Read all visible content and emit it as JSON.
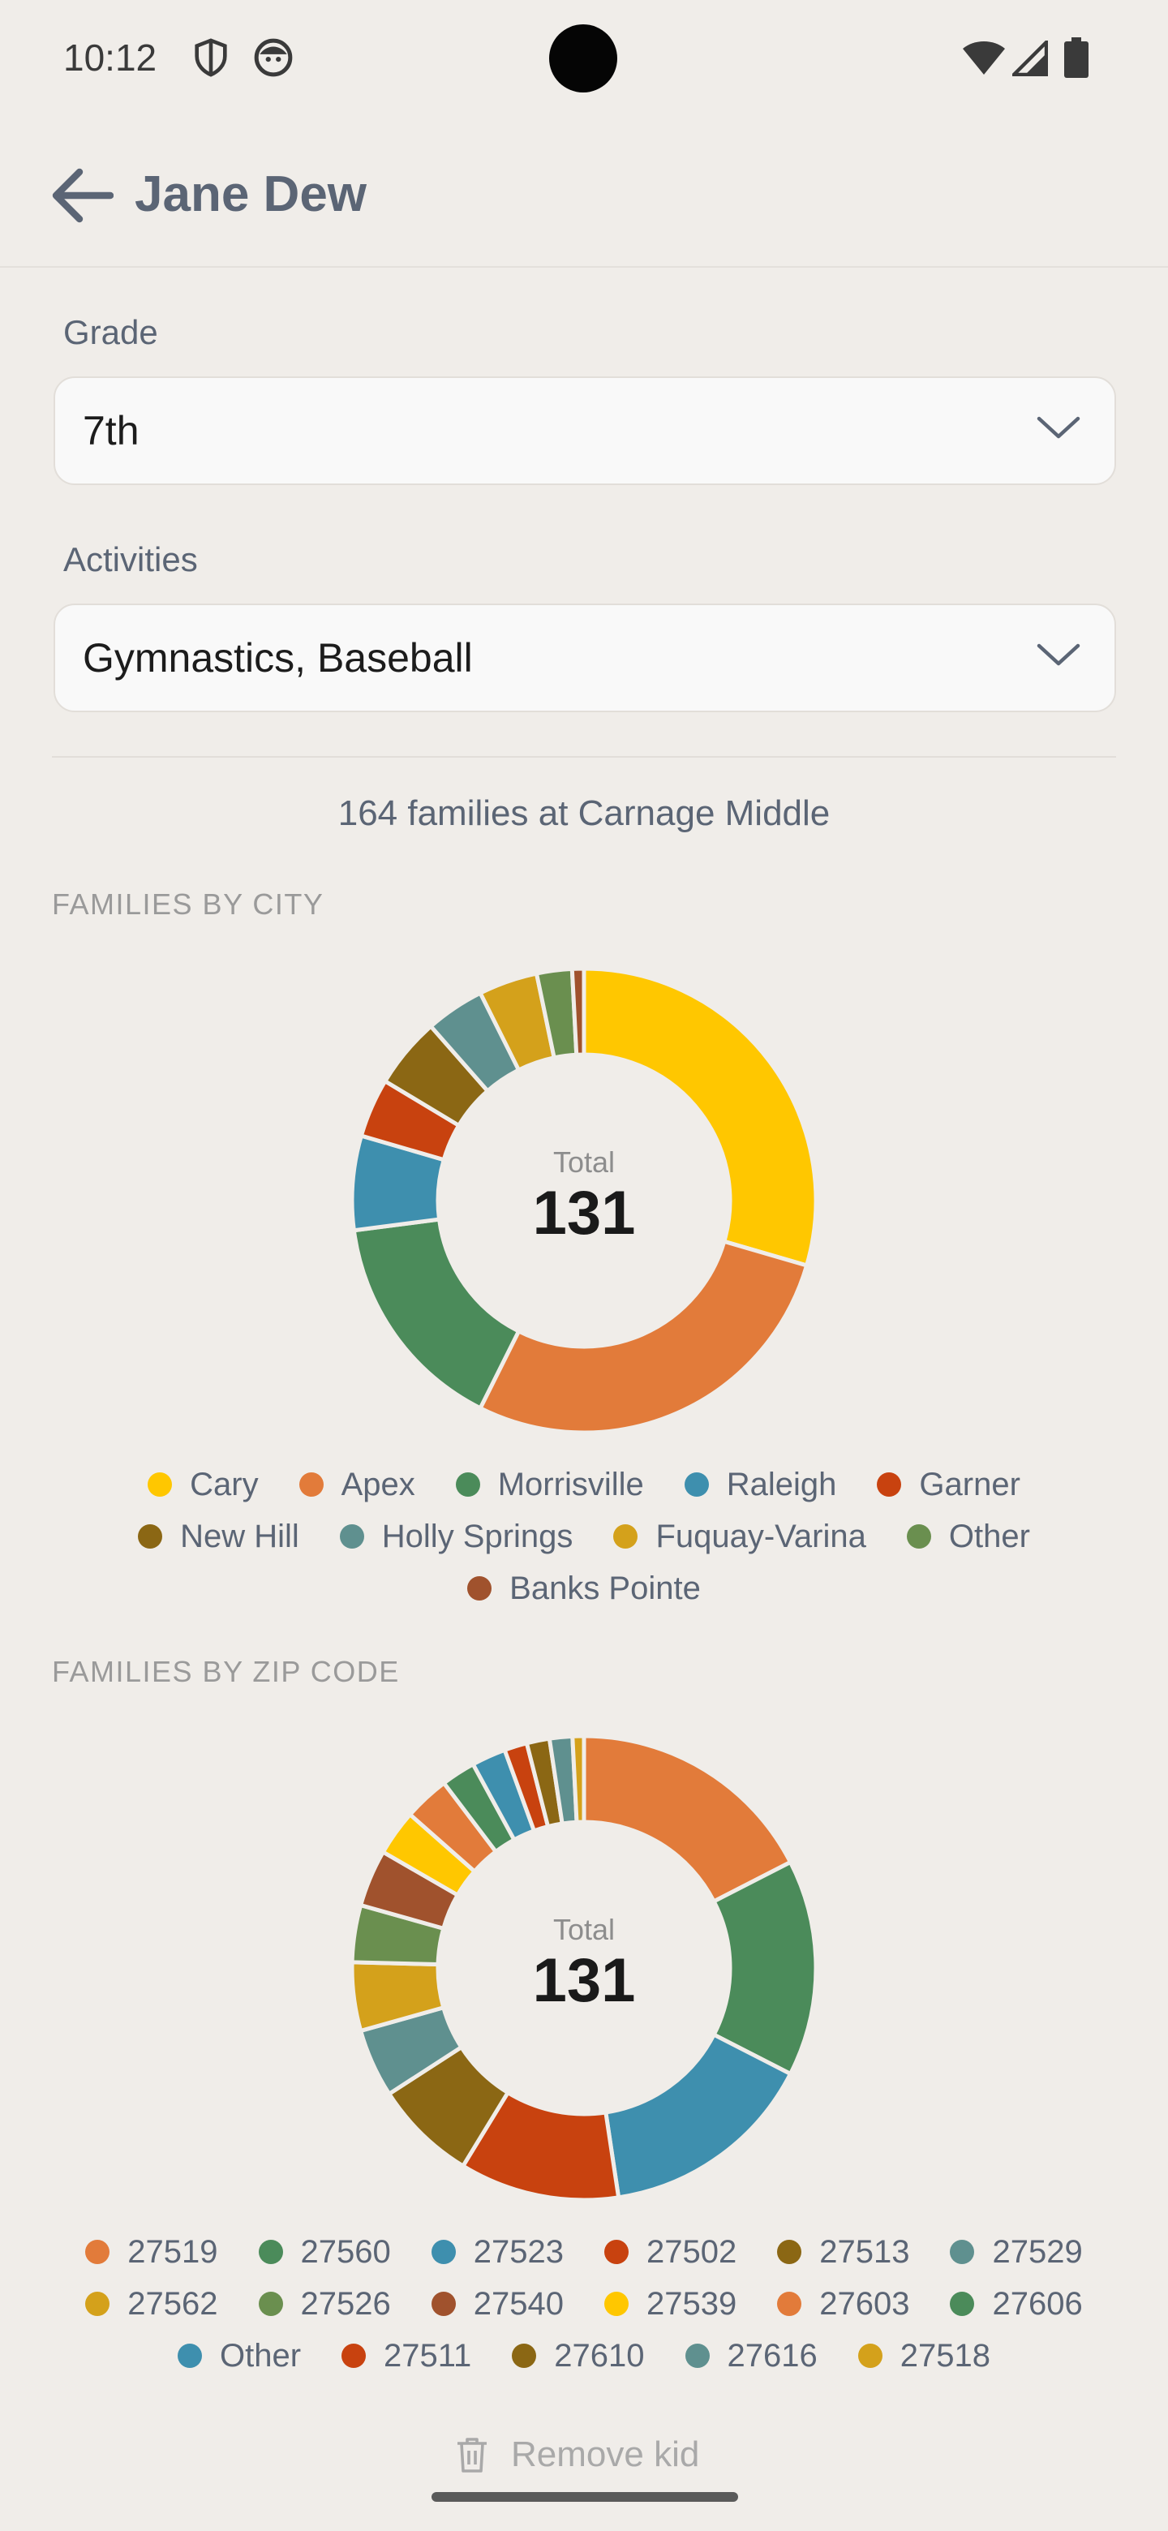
{
  "status": {
    "time": "10:12"
  },
  "header": {
    "title": "Jane Dew"
  },
  "grade": {
    "label": "Grade",
    "value": "7th"
  },
  "activities": {
    "label": "Activities",
    "value": "Gymnastics, Baseball"
  },
  "summary": "164 families at Carnage Middle",
  "city_chart": {
    "section_title": "FAMILIES BY CITY",
    "total_label": "Total",
    "total_value": "131"
  },
  "zip_chart": {
    "section_title": "FAMILIES BY ZIP CODE",
    "total_label": "Total",
    "total_value": "131"
  },
  "remove_label": "Remove kid",
  "icons": {
    "back": "arrow-left-icon",
    "chevron": "chevron-down-icon",
    "trash": "trash-icon",
    "shield": "shield-icon",
    "face": "face-icon",
    "wifi": "wifi-icon",
    "signal": "signal-icon",
    "battery": "battery-icon"
  },
  "chart_data": [
    {
      "type": "pie",
      "title": "FAMILIES BY CITY",
      "total": 131,
      "categories": [
        "Cary",
        "Apex",
        "Morrisville",
        "Raleigh",
        "Garner",
        "New Hill",
        "Holly Springs",
        "Fuquay-Varina",
        "Other",
        "Banks Pointe"
      ],
      "values": [
        36,
        34,
        19,
        8,
        5,
        6,
        5,
        5,
        3,
        1
      ],
      "colors": [
        "#FFC700",
        "#E27B3A",
        "#4B8B5A",
        "#3E8FAE",
        "#C8420F",
        "#8B6714",
        "#5F908F",
        "#D4A11B",
        "#6A8F4F",
        "#A0522D"
      ],
      "legend": "bottom"
    },
    {
      "type": "pie",
      "title": "FAMILIES BY ZIP CODE",
      "total": 131,
      "categories": [
        "27519",
        "27560",
        "27523",
        "27502",
        "27513",
        "27529",
        "27562",
        "27526",
        "27540",
        "27539",
        "27603",
        "27606",
        "Other",
        "27511",
        "27610",
        "27616",
        "27518"
      ],
      "values": [
        22,
        19,
        19,
        14,
        9,
        6,
        6,
        5,
        5,
        4,
        4,
        3,
        3,
        2,
        2,
        2,
        1
      ],
      "colors": [
        "#E27B3A",
        "#4B8B5A",
        "#3E8FAE",
        "#C8420F",
        "#8B6714",
        "#5F908F",
        "#D4A11B",
        "#6A8F4F",
        "#A0522D",
        "#FFC700",
        "#E27B3A",
        "#4B8B5A",
        "#3E8FAE",
        "#C8420F",
        "#8B6714",
        "#5F908F",
        "#D4A11B"
      ],
      "legend": "bottom"
    }
  ]
}
